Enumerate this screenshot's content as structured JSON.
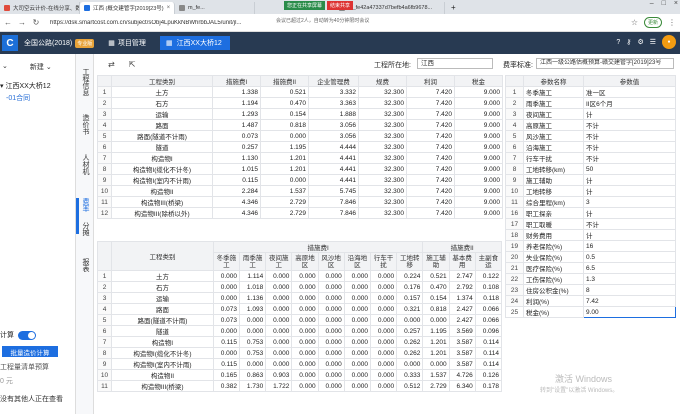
{
  "browser": {
    "tabs": [
      {
        "label": "大司空云计价-在线分享、数字协"
      },
      {
        "label": "江西 (概交建管字[2019]23号)"
      },
      {
        "label": "m_fe..."
      },
      {
        "label": "m_fe42a47337d7befb4a6fb9678..."
      }
    ],
    "share_status": "您正在共享屏幕",
    "share_end": "结束共享",
    "url": "https://dsk.smartcost.com.cn/subject/sObj4LpuKkNBWhrbbJAL5/unit/jl...",
    "notice": "会议已超过2人，自动转为40分钟限时会议",
    "update": "更新"
  },
  "app": {
    "logo": "C",
    "name": "全国公路(2018)",
    "pro_badge": "专业版",
    "project_mgmt": "项目管理",
    "active_tab": "江西XX大桥12"
  },
  "sidebar": {
    "new_label": "新建",
    "tree_root": "江西XX大桥12",
    "tree_child": "-01合同",
    "calc_label": "计算",
    "batch_calc": "批量造价计算",
    "listing": "工程量清单预算",
    "price": "0 元",
    "nobody": "没有其他人正在查看"
  },
  "vnav": [
    "工程信息",
    "造价书",
    "人材机",
    "费率",
    "分摊",
    "报表"
  ],
  "toolbar": {
    "location_label": "工程所在地:",
    "location_value": "江西",
    "standard_label": "费率标准:",
    "standard_value": "江西一级公路估概预算-赣交建管字[2019]23号"
  },
  "rate_table": {
    "headers": [
      "工程类别",
      "措施费I",
      "措施费II",
      "企业管理费",
      "规费",
      "利润",
      "税金"
    ],
    "rows": [
      [
        "1",
        "土方",
        "1.338",
        "0.521",
        "3.332",
        "32.300",
        "7.420",
        "9.000"
      ],
      [
        "2",
        "石方",
        "1.194",
        "0.470",
        "3.363",
        "32.300",
        "7.420",
        "9.000"
      ],
      [
        "3",
        "运输",
        "1.293",
        "0.154",
        "1.888",
        "32.300",
        "7.420",
        "9.000"
      ],
      [
        "4",
        "路面",
        "1.487",
        "0.818",
        "3.056",
        "32.300",
        "7.420",
        "9.000"
      ],
      [
        "5",
        "路面(隧道不计雨)",
        "0.073",
        "0.000",
        "3.056",
        "32.300",
        "7.420",
        "9.000"
      ],
      [
        "6",
        "隧道",
        "0.257",
        "1.195",
        "4.444",
        "32.300",
        "7.420",
        "9.000"
      ],
      [
        "7",
        "构造物I",
        "1.130",
        "1.201",
        "4.441",
        "32.300",
        "7.420",
        "9.000"
      ],
      [
        "8",
        "构造物I(缆化不计冬)",
        "1.015",
        "1.201",
        "4.441",
        "32.300",
        "7.420",
        "9.000"
      ],
      [
        "9",
        "构造物I(室内不计雨)",
        "0.115",
        "0.000",
        "4.441",
        "32.300",
        "7.420",
        "9.000"
      ],
      [
        "10",
        "构造物II",
        "2.284",
        "1.537",
        "5.745",
        "32.300",
        "7.420",
        "9.000"
      ],
      [
        "11",
        "构造物III(桥梁)",
        "4.346",
        "2.729",
        "7.846",
        "32.300",
        "7.420",
        "9.000"
      ],
      [
        "12",
        "构造物III(除桥以外)",
        "4.346",
        "2.729",
        "7.846",
        "32.300",
        "7.420",
        "9.000"
      ]
    ]
  },
  "detail_table": {
    "header_top": {
      "category": "工程类别",
      "group1": "措施费I",
      "group2": "措施费II"
    },
    "headers": [
      "冬季施工",
      "雨季施工",
      "夜间施工",
      "高原地区",
      "风沙地区",
      "沿海地区",
      "行车干扰",
      "工地转移",
      "施工辅助",
      "基本费用",
      "主副食运"
    ],
    "rows": [
      [
        "1",
        "土方",
        "0.000",
        "1.114",
        "0.000",
        "0.000",
        "0.000",
        "0.000",
        "0.000",
        "0.224",
        "0.521",
        "2.747",
        "0.122"
      ],
      [
        "2",
        "石方",
        "0.000",
        "1.018",
        "0.000",
        "0.000",
        "0.000",
        "0.000",
        "0.000",
        "0.176",
        "0.470",
        "2.792",
        "0.108"
      ],
      [
        "3",
        "运输",
        "0.000",
        "1.136",
        "0.000",
        "0.000",
        "0.000",
        "0.000",
        "0.000",
        "0.157",
        "0.154",
        "1.374",
        "0.118"
      ],
      [
        "4",
        "路面",
        "0.073",
        "1.093",
        "0.000",
        "0.000",
        "0.000",
        "0.000",
        "0.000",
        "0.321",
        "0.818",
        "2.427",
        "0.066"
      ],
      [
        "5",
        "路面(隧道不计雨)",
        "0.073",
        "0.000",
        "0.000",
        "0.000",
        "0.000",
        "0.000",
        "0.000",
        "0.000",
        "0.000",
        "2.427",
        "0.066"
      ],
      [
        "6",
        "隧道",
        "0.000",
        "0.000",
        "0.000",
        "0.000",
        "0.000",
        "0.000",
        "0.000",
        "0.257",
        "1.195",
        "3.569",
        "0.096"
      ],
      [
        "7",
        "构造物I",
        "0.115",
        "0.753",
        "0.000",
        "0.000",
        "0.000",
        "0.000",
        "0.000",
        "0.262",
        "1.201",
        "3.587",
        "0.114"
      ],
      [
        "8",
        "构造物I(缆化不计冬)",
        "0.000",
        "0.753",
        "0.000",
        "0.000",
        "0.000",
        "0.000",
        "0.000",
        "0.262",
        "1.201",
        "3.587",
        "0.114"
      ],
      [
        "9",
        "构造物I(室内不计雨)",
        "0.115",
        "0.000",
        "0.000",
        "0.000",
        "0.000",
        "0.000",
        "0.000",
        "0.000",
        "0.000",
        "3.587",
        "0.114"
      ],
      [
        "10",
        "构造物II",
        "0.165",
        "0.863",
        "0.903",
        "0.000",
        "0.000",
        "0.000",
        "0.000",
        "0.333",
        "1.537",
        "4.726",
        "0.126"
      ],
      [
        "11",
        "构造物III(桥梁)",
        "0.382",
        "1.730",
        "1.722",
        "0.000",
        "0.000",
        "0.000",
        "0.000",
        "0.512",
        "2.729",
        "6.340",
        "0.178"
      ]
    ]
  },
  "param_table": {
    "headers": [
      "参数名称",
      "参数值"
    ],
    "rows": [
      [
        "1",
        "冬季施工",
        "准一区"
      ],
      [
        "2",
        "雨季施工",
        "II区6个月"
      ],
      [
        "3",
        "夜间施工",
        "计"
      ],
      [
        "4",
        "高原施工",
        "不计"
      ],
      [
        "5",
        "风沙施工",
        "不计"
      ],
      [
        "6",
        "沿海施工",
        "不计"
      ],
      [
        "7",
        "行车干扰",
        "不计"
      ],
      [
        "8",
        "工地转移(km)",
        "50"
      ],
      [
        "9",
        "施工辅助",
        "计"
      ],
      [
        "10",
        "工地转移",
        "计"
      ],
      [
        "11",
        "综合里程(km)",
        "3"
      ],
      [
        "16",
        "职工探亲",
        "计"
      ],
      [
        "17",
        "职工取暖",
        "不计"
      ],
      [
        "18",
        "财务费用",
        "计"
      ],
      [
        "19",
        "养老保险(%)",
        "16"
      ],
      [
        "20",
        "失业保险(%)",
        "0.5"
      ],
      [
        "21",
        "医疗保险(%)",
        "6.5"
      ],
      [
        "22",
        "工伤保险(%)",
        "1.3"
      ],
      [
        "23",
        "住房公积金(%)",
        "8"
      ],
      [
        "24",
        "利润(%)",
        "7.42"
      ],
      [
        "25",
        "税金(%)",
        "9.00"
      ]
    ]
  },
  "watermark": {
    "title": "激活 Windows",
    "subtitle": "转到\"设置\"以激活 Windows。"
  }
}
